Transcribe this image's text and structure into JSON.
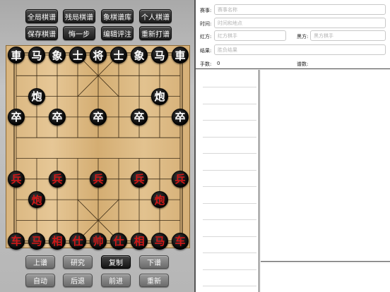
{
  "top_buttons": [
    "全局棋谱",
    "残局棋谱",
    "象棋谱库",
    "个人棋谱",
    "保存棋谱",
    "悔一步",
    "编辑评注",
    "重新打谱"
  ],
  "bottom_buttons": [
    "上谱",
    "研究",
    "复制",
    "下谱",
    "自动",
    "后退",
    "前进",
    "重新"
  ],
  "info": {
    "event_label": "赛事:",
    "event_placeholder": "赛事名称",
    "time_label": "时间:",
    "time_placeholder": "时间和地点",
    "red_label": "红方:",
    "red_placeholder": "红方棋手",
    "black_label": "黑方:",
    "black_placeholder": "黑方棋手",
    "result_label": "结果:",
    "result_placeholder": "胜负结果",
    "moves_label": "手数:",
    "moves_value": "0",
    "score_label": "谱数:"
  },
  "pieces": [
    {
      "char": "車",
      "side": "black",
      "file": 0,
      "rank": 0
    },
    {
      "char": "马",
      "side": "black",
      "file": 1,
      "rank": 0
    },
    {
      "char": "象",
      "side": "black",
      "file": 2,
      "rank": 0
    },
    {
      "char": "士",
      "side": "black",
      "file": 3,
      "rank": 0
    },
    {
      "char": "将",
      "side": "black",
      "file": 4,
      "rank": 0
    },
    {
      "char": "士",
      "side": "black",
      "file": 5,
      "rank": 0
    },
    {
      "char": "象",
      "side": "black",
      "file": 6,
      "rank": 0
    },
    {
      "char": "马",
      "side": "black",
      "file": 7,
      "rank": 0
    },
    {
      "char": "車",
      "side": "black",
      "file": 8,
      "rank": 0
    },
    {
      "char": "炮",
      "side": "black",
      "file": 1,
      "rank": 2
    },
    {
      "char": "炮",
      "side": "black",
      "file": 7,
      "rank": 2
    },
    {
      "char": "卒",
      "side": "black",
      "file": 0,
      "rank": 3
    },
    {
      "char": "卒",
      "side": "black",
      "file": 2,
      "rank": 3
    },
    {
      "char": "卒",
      "side": "black",
      "file": 4,
      "rank": 3
    },
    {
      "char": "卒",
      "side": "black",
      "file": 6,
      "rank": 3
    },
    {
      "char": "卒",
      "side": "black",
      "file": 8,
      "rank": 3
    },
    {
      "char": "兵",
      "side": "red",
      "file": 0,
      "rank": 6
    },
    {
      "char": "兵",
      "side": "red",
      "file": 2,
      "rank": 6
    },
    {
      "char": "兵",
      "side": "red",
      "file": 4,
      "rank": 6
    },
    {
      "char": "兵",
      "side": "red",
      "file": 6,
      "rank": 6
    },
    {
      "char": "兵",
      "side": "red",
      "file": 8,
      "rank": 6
    },
    {
      "char": "炮",
      "side": "red",
      "file": 1,
      "rank": 7
    },
    {
      "char": "炮",
      "side": "red",
      "file": 7,
      "rank": 7
    },
    {
      "char": "车",
      "side": "red",
      "file": 0,
      "rank": 9
    },
    {
      "char": "马",
      "side": "red",
      "file": 1,
      "rank": 9
    },
    {
      "char": "相",
      "side": "red",
      "file": 2,
      "rank": 9
    },
    {
      "char": "仕",
      "side": "red",
      "file": 3,
      "rank": 9
    },
    {
      "char": "帅",
      "side": "red",
      "file": 4,
      "rank": 9
    },
    {
      "char": "仕",
      "side": "red",
      "file": 5,
      "rank": 9
    },
    {
      "char": "相",
      "side": "red",
      "file": 6,
      "rank": 9
    },
    {
      "char": "马",
      "side": "red",
      "file": 7,
      "rank": 9
    },
    {
      "char": "车",
      "side": "red",
      "file": 8,
      "rank": 9
    }
  ],
  "colors": {
    "red_piece_text": "#d01818",
    "black_piece_text": "#ffffff",
    "board": "#e0bf8c"
  }
}
